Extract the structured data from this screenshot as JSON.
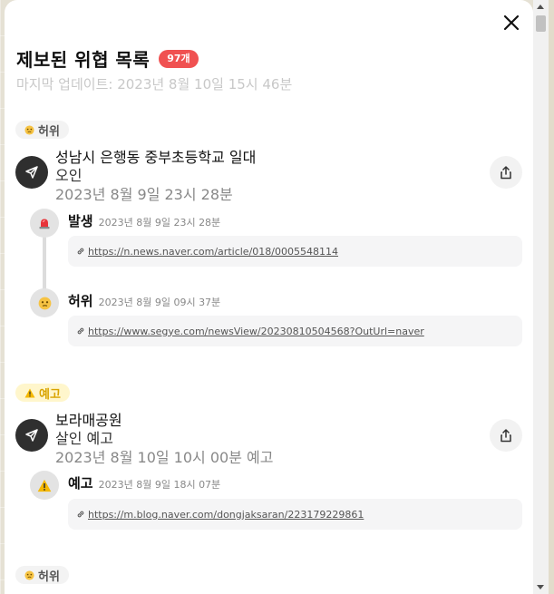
{
  "panel": {
    "title": "제보된 위협 목록",
    "count_badge": "97개",
    "updated": "마지막 업데이트: 2023년 8월 10일 15시 46분"
  },
  "reports": [
    {
      "tag": "허위",
      "tag_icon": "confused-face-icon",
      "location": "성남시 은행동 중부초등학교 일대",
      "subtitle": "오인",
      "date": "2023년 8월 9일 23시 28분",
      "events": [
        {
          "name": "발생",
          "icon": "siren-icon",
          "date": "2023년 8월 9일 23시 28분",
          "link": "https://n.news.naver.com/article/018/0005548114"
        },
        {
          "name": "허위",
          "icon": "confused-face-icon",
          "date": "2023년 8월 9일 09시 37분",
          "link": "https://www.segye.com/newsView/20230810504568?OutUrl=naver"
        }
      ]
    },
    {
      "tag": "예고",
      "tag_icon": "warning-icon",
      "location": "보라매공원",
      "subtitle": "살인 예고",
      "date": "2023년 8월 10일 10시 00분 예고",
      "events": [
        {
          "name": "예고",
          "icon": "warning-icon",
          "date": "2023년 8월 9일 18시 07분",
          "link": "https://m.blog.naver.com/dongjaksaran/223179229861"
        }
      ]
    },
    {
      "tag": "허위",
      "tag_icon": "confused-face-icon"
    }
  ],
  "colors": {
    "badge": "#f05151",
    "warn_tag_bg": "#fff6cc",
    "warn_tag_text": "#d9a400",
    "report_icon_bg": "#2f2f2f"
  }
}
